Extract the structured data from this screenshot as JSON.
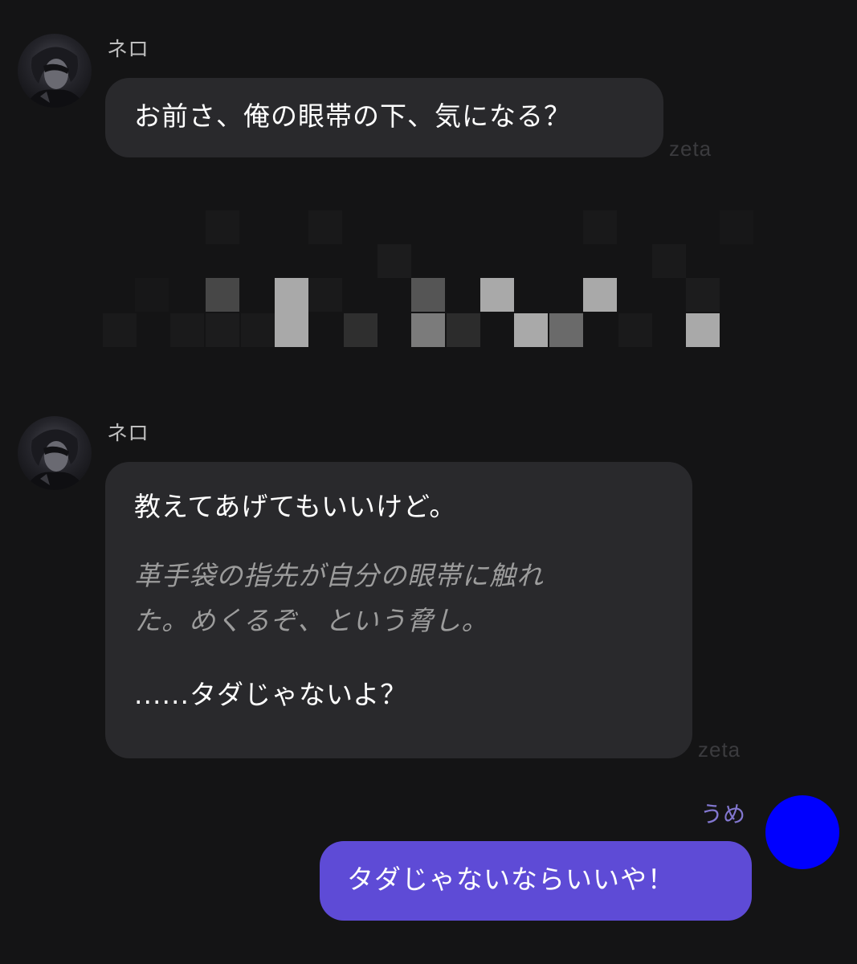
{
  "messages": [
    {
      "sender": "ネロ",
      "text": "お前さ、俺の眼帯の下、気になる？",
      "watermark": "zeta"
    },
    {
      "sender": "ネロ",
      "line1": "教えてあげてもいいけど。",
      "narration": "革手袋の指先が自分の眼帯に触れた。めくるぞ、という脅し。",
      "narration_line1": "革手袋の指先が自分の眼帯に触れ",
      "narration_line2": "た。めくるぞ、という脅し。",
      "line3": "......タダじゃないよ？",
      "watermark": "zeta"
    }
  ],
  "user_message": {
    "sender": "うめ",
    "text": "タダじゃないならいいや！",
    "avatar_color": "#0000ff"
  },
  "colors": {
    "background": "#141415",
    "bot_bubble": "#29292c",
    "user_bubble": "#5e4bd6",
    "user_name": "#8277d0",
    "sender_name": "#bdbdbd",
    "narration": "#9c9c9c"
  },
  "icons": {
    "bot_avatar": "character-avatar-icon",
    "user_avatar": "user-avatar-icon"
  }
}
